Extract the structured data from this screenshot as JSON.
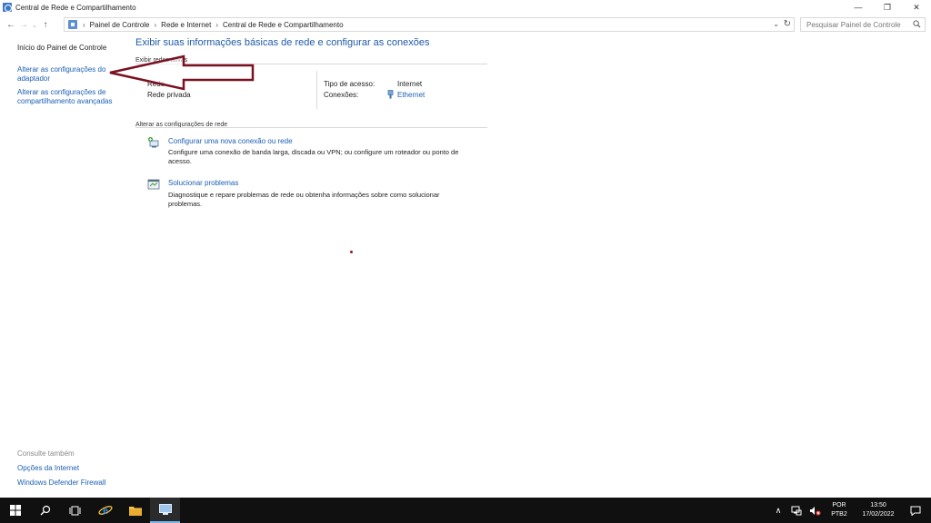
{
  "window": {
    "title": "Central de Rede e Compartilhamento",
    "minimize_glyph": "—",
    "maximize_glyph": "❐",
    "close_glyph": "✕"
  },
  "nav": {
    "back_glyph": "←",
    "forward_glyph": "→",
    "recent_glyph": "⌄",
    "up_glyph": "↑",
    "breadcrumbs": [
      "Painel de Controle",
      "Rede e Internet",
      "Central de Rede e Compartilhamento"
    ],
    "breadcrumb_sep": "›",
    "dropdown_glyph": "⌄",
    "refresh_glyph": "↻",
    "search_placeholder": "Pesquisar Painel de Controle"
  },
  "left_pane": {
    "home_link": "Início do Painel de Controle",
    "adapter_link": "Alterar as configurações do adaptador",
    "sharing_link": "Alterar as configurações de compartilhamento avançadas",
    "see_also_label": "Consulte também",
    "see_also_links": [
      "Opções da Internet",
      "Windows Defender Firewall"
    ]
  },
  "main": {
    "heading": "Exibir suas informações básicas de rede e configurar as conexões",
    "active_networks_label": "Exibir redes ativas",
    "network_name": "Rede",
    "network_type": "Rede privada",
    "access_type_label": "Tipo de acesso:",
    "access_type_value": "Internet",
    "connections_label": "Conexões:",
    "connections_value": "Ethernet",
    "change_settings_label": "Alterar as configurações de rede",
    "tasks": [
      {
        "title": "Configurar uma nova conexão ou rede",
        "description": "Configure uma conexão de banda larga, discada ou VPN; ou configure um roteador ou ponto de acesso."
      },
      {
        "title": "Solucionar problemas",
        "description": "Diagnostique e repare problemas de rede ou obtenha informações sobre como solucionar problemas."
      }
    ]
  },
  "taskbar": {
    "language_line1": "POR",
    "language_line2": "PTB2",
    "time": "13:50",
    "date": "17/02/2022",
    "tray_up_glyph": "∧"
  },
  "colors": {
    "link": "#1a5fb4",
    "heading": "#1e5aa8",
    "annotation_arrow": "#7a1020",
    "taskbar": "#101010"
  }
}
